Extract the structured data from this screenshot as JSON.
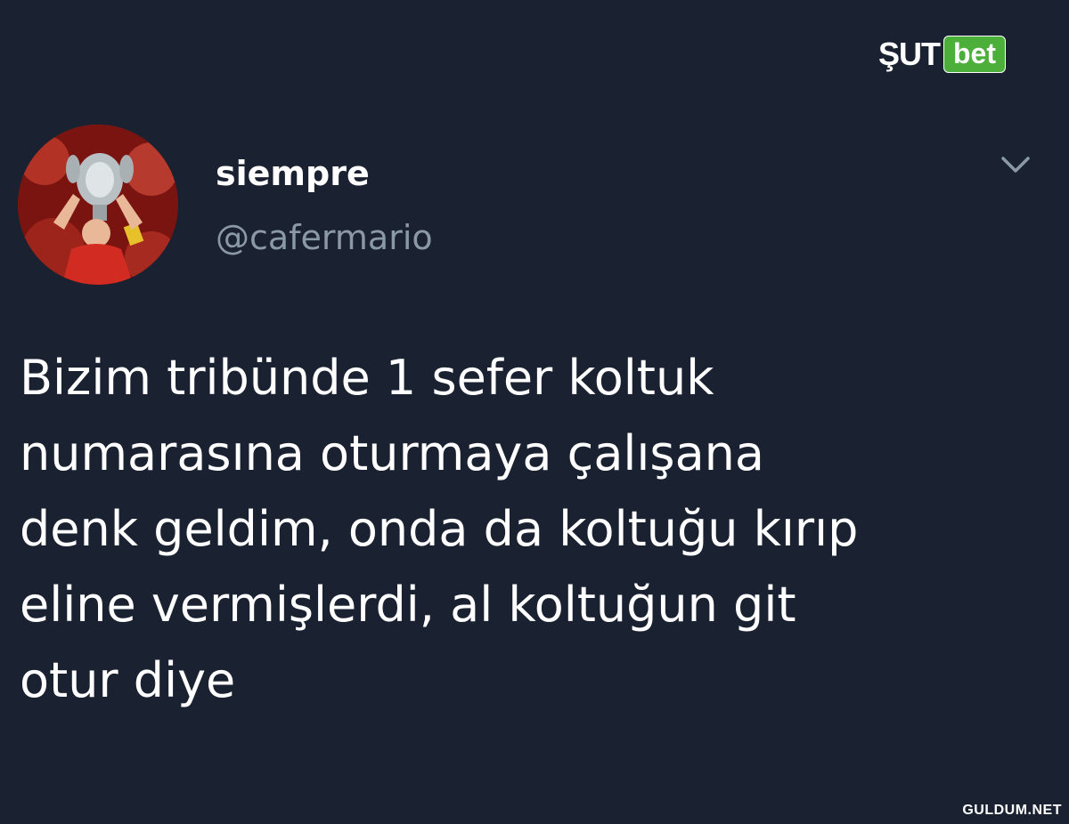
{
  "brand": {
    "logo_left": "ŞUT",
    "logo_right": "bet",
    "accent": "#4caf3a"
  },
  "tweet": {
    "display_name": "siempre",
    "handle": "@cafermario",
    "text": "Bizim tribünde 1 sefer koltuk\nnumarasına oturmaya çalışana\ndenk geldim, onda da koltuğu kırıp\neline vermişlerdi, al koltuğun git\notur diye",
    "menu_icon": "chevron-down-icon"
  },
  "watermark": "GULDUM.NET",
  "colors": {
    "background": "#1a2231",
    "text": "#ffffff",
    "secondary_text": "#8b98a6"
  }
}
